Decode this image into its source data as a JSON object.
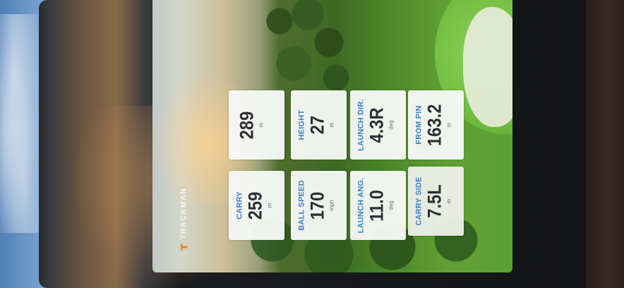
{
  "app": {
    "brand": "TRACKMAN"
  },
  "tiles": [
    {
      "id": "carry",
      "label": "CARRY",
      "value": "259",
      "unit": "m"
    },
    {
      "id": "total",
      "label": "",
      "value": "289",
      "unit": "m"
    },
    {
      "id": "ball_speed",
      "label": "BALL SPEED",
      "value": "170",
      "unit": "mph"
    },
    {
      "id": "height",
      "label": "HEIGHT",
      "value": "27",
      "unit": "m"
    },
    {
      "id": "launch_ang",
      "label": "LAUNCH ANG.",
      "value": "11.0",
      "unit": "deg"
    },
    {
      "id": "launch_dir",
      "label": "LAUNCH DIR.",
      "value": "4.3R",
      "unit": "deg"
    },
    {
      "id": "carry_side",
      "label": "CARRY SIDE",
      "value": "7.5L",
      "unit": "m"
    },
    {
      "id": "from_pin",
      "label": "FROM PIN",
      "value": "163.2",
      "unit": "m"
    }
  ],
  "colors": {
    "label_blue": "#3f80c8",
    "value_dark": "#2d2f33",
    "tile_bg": "#f6f8f6",
    "brand_orange": "#e8892e"
  },
  "icons": {
    "brand_logo": "trackman-logo-icon"
  }
}
